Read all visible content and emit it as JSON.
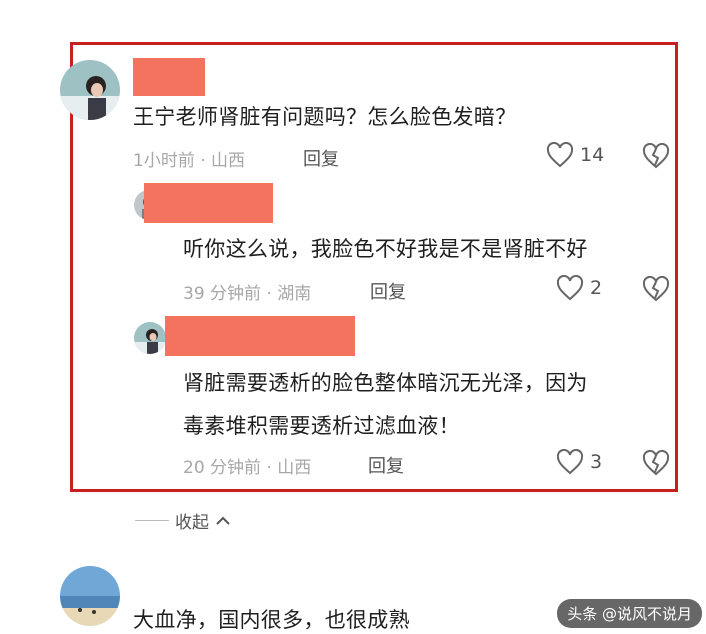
{
  "comments": [
    {
      "text": "王宁老师肾脏有问题吗？怎么脸色发暗？",
      "meta": "1小时前 · 山西",
      "reply_label": "回复",
      "likes": "14"
    },
    {
      "text": "听你这么说，我脸色不好我是不是肾脏不好",
      "meta": "39 分钟前 · 湖南",
      "reply_label": "回复",
      "likes": "2"
    },
    {
      "text_line1": "肾脏需要透析的脸色整体暗沉无光泽，因为",
      "text_line2": "毒素堆积需要透析过滤血液！",
      "meta": "20 分钟前 · 山西",
      "reply_label": "回复",
      "likes": "3"
    },
    {
      "text": "大血净，国内很多，也很成熟"
    }
  ],
  "collapse_label": "收起",
  "watermark": "头条 @说风不说月",
  "colors": {
    "highlight_border": "#c8201e",
    "redaction": "#f4735f",
    "meta_gray": "#a7a7a7"
  }
}
